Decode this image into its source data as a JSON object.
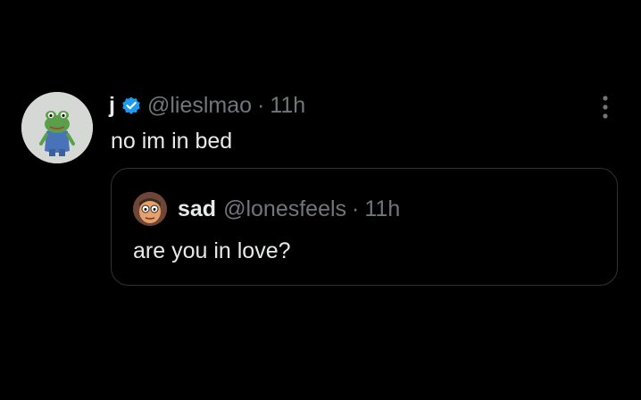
{
  "tweet": {
    "display_name": "j",
    "handle": "@lieslmao",
    "separator": "·",
    "time": "11h",
    "text": "no im in bed",
    "avatar_icon": "frog-avatar",
    "verified_icon": "verified-badge-icon",
    "more_icon": "more-vertical-icon"
  },
  "quoted_tweet": {
    "display_name": "sad",
    "handle": "@lonesfeels",
    "separator": "·",
    "time": "11h",
    "text": "are you in love?",
    "avatar_icon": "cartoon-avatar"
  },
  "colors": {
    "background": "#000000",
    "text_primary": "#e7e9ea",
    "text_secondary": "#71767b",
    "verified_blue": "#1d9bf0",
    "border": "#2f3336"
  }
}
